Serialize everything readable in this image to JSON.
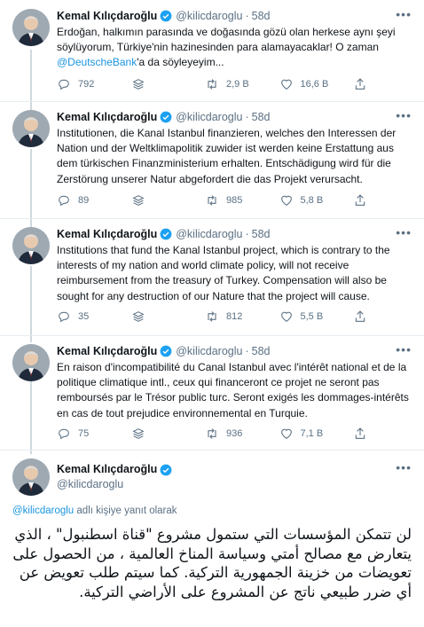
{
  "tweets": [
    {
      "name": "Kemal Kılıçdaroğlu",
      "handle": "@kilicdaroglu",
      "dot": "·",
      "time": "58d",
      "text_parts": [
        "Erdoğan, halkımın parasında ve doğasında gözü olan herkese aynı şeyi söylüyorum, Türkiye'nin hazinesinden para alamayacaklar! O zaman ",
        "@DeutscheBank",
        "'a da söyleyeyim..."
      ],
      "replies": "792",
      "retweets": "2,9 B",
      "likes": "16,6 B"
    },
    {
      "name": "Kemal Kılıçdaroğlu",
      "handle": "@kilicdaroglu",
      "dot": "·",
      "time": "58d",
      "text": "Institutionen, die Kanal Istanbul finanzieren, welches den Interessen der Nation und der Weltklimapolitik zuwider ist werden keine Erstattung aus dem türkischen Finanzministerium erhalten. Entschädigung wird für die Zerstörung unserer Natur abgefordert die das Projekt verursacht.",
      "replies": "89",
      "retweets": "985",
      "likes": "5,8 B"
    },
    {
      "name": "Kemal Kılıçdaroğlu",
      "handle": "@kilicdaroglu",
      "dot": "·",
      "time": "58d",
      "text": "Institutions that fund the Kanal Istanbul project, which is contrary to the interests of my nation and world climate policy, will not receive reimbursement from the treasury of Turkey. Compensation will also be sought for any destruction of our Nature that the project will cause.",
      "replies": "35",
      "retweets": "812",
      "likes": "5,5 B"
    },
    {
      "name": "Kemal Kılıçdaroğlu",
      "handle": "@kilicdaroglu",
      "dot": "·",
      "time": "58d",
      "text": "En raison d'incompatibilité du Canal Istanbul avec l'intérêt national et de la politique climatique intl., ceux qui financeront ce projet ne seront pas remboursés par le Trésor public turc. Seront exigés les dommages-intérêts en cas de tout prejudice environnemental en Turquie.",
      "replies": "75",
      "retweets": "936",
      "likes": "7,1 B"
    }
  ],
  "focused": {
    "name": "Kemal Kılıçdaroğlu",
    "handle": "@kilicdaroglu",
    "replying_mention": "@kilicdaroglu",
    "replying_suffix": " adlı kişiye yanıt olarak",
    "text": "لن تتمكن المؤسسات التي ستمول مشروع \"قناة اسطنبول\" ، الذي يتعارض مع مصالح أمتي وسياسة المناخ العالمية ، من الحصول على تعويضات من خزينة الجمهورية التركية. كما سيتم طلب تعويض عن أي ضرر طبيعي ناتج عن المشروع على الأراضي التركية."
  },
  "icons": {
    "avatar": "avatar-portrait",
    "verified": "verified-badge-icon",
    "more": "more-icon",
    "reply": "reply-icon",
    "stack": "stack-icon",
    "retweet": "retweet-icon",
    "like": "heart-icon",
    "share": "share-icon"
  },
  "colors": {
    "accent": "#1b95e0",
    "muted": "#5b7083",
    "verified": "#1da1f2"
  }
}
